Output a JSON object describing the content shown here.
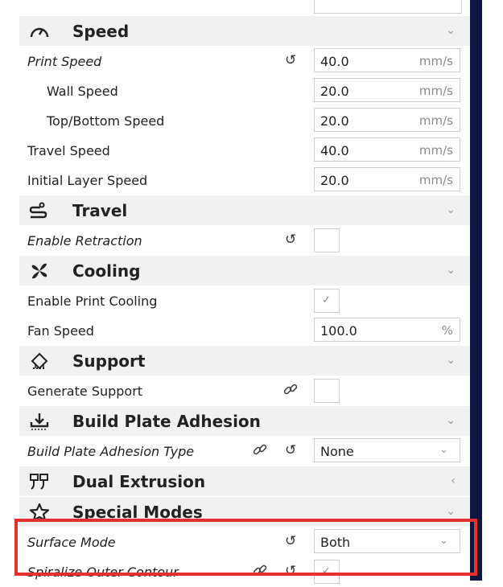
{
  "categories": {
    "speed": {
      "label": "Speed",
      "icon": "speedometer-icon",
      "chevron": "⌄"
    },
    "travel": {
      "label": "Travel",
      "icon": "travel-icon",
      "chevron": "⌄"
    },
    "cooling": {
      "label": "Cooling",
      "icon": "fan-icon",
      "chevron": "⌄"
    },
    "support": {
      "label": "Support",
      "icon": "support-icon",
      "chevron": "⌄"
    },
    "adhesion": {
      "label": "Build Plate Adhesion",
      "icon": "build-plate-icon",
      "chevron": "⌄"
    },
    "dual": {
      "label": "Dual Extrusion",
      "icon": "dual-extrusion-icon",
      "chevron": "‹"
    },
    "special": {
      "label": "Special Modes",
      "icon": "star-icon",
      "chevron": "⌄"
    }
  },
  "settings": {
    "print_speed": {
      "label": "Print Speed",
      "value": "40.0",
      "unit": "mm/s"
    },
    "wall_speed": {
      "label": "Wall Speed",
      "value": "20.0",
      "unit": "mm/s"
    },
    "topbottom_speed": {
      "label": "Top/Bottom Speed",
      "value": "20.0",
      "unit": "mm/s"
    },
    "travel_speed": {
      "label": "Travel Speed",
      "value": "40.0",
      "unit": "mm/s"
    },
    "initial_layer_speed": {
      "label": "Initial Layer Speed",
      "value": "20.0",
      "unit": "mm/s"
    },
    "enable_retraction": {
      "label": "Enable Retraction",
      "checked": false
    },
    "enable_print_cooling": {
      "label": "Enable Print Cooling",
      "checked": true,
      "mark": "✓"
    },
    "fan_speed": {
      "label": "Fan Speed",
      "value": "100.0",
      "unit": "%"
    },
    "generate_support": {
      "label": "Generate Support",
      "checked": false
    },
    "adhesion_type": {
      "label": "Build Plate Adhesion Type",
      "value": "None",
      "arrow": "⌄"
    },
    "surface_mode": {
      "label": "Surface Mode",
      "value": "Both",
      "arrow": "⌄"
    },
    "spiralize": {
      "label": "Spiralize Outer Contour",
      "checked": true,
      "mark": "✓"
    }
  },
  "icons": {
    "reset": "↺",
    "link": "🔗"
  },
  "colors": {
    "highlight_border": "#e53030",
    "category_bg": "#f1f1f1",
    "side_bar": "#0f1640"
  }
}
